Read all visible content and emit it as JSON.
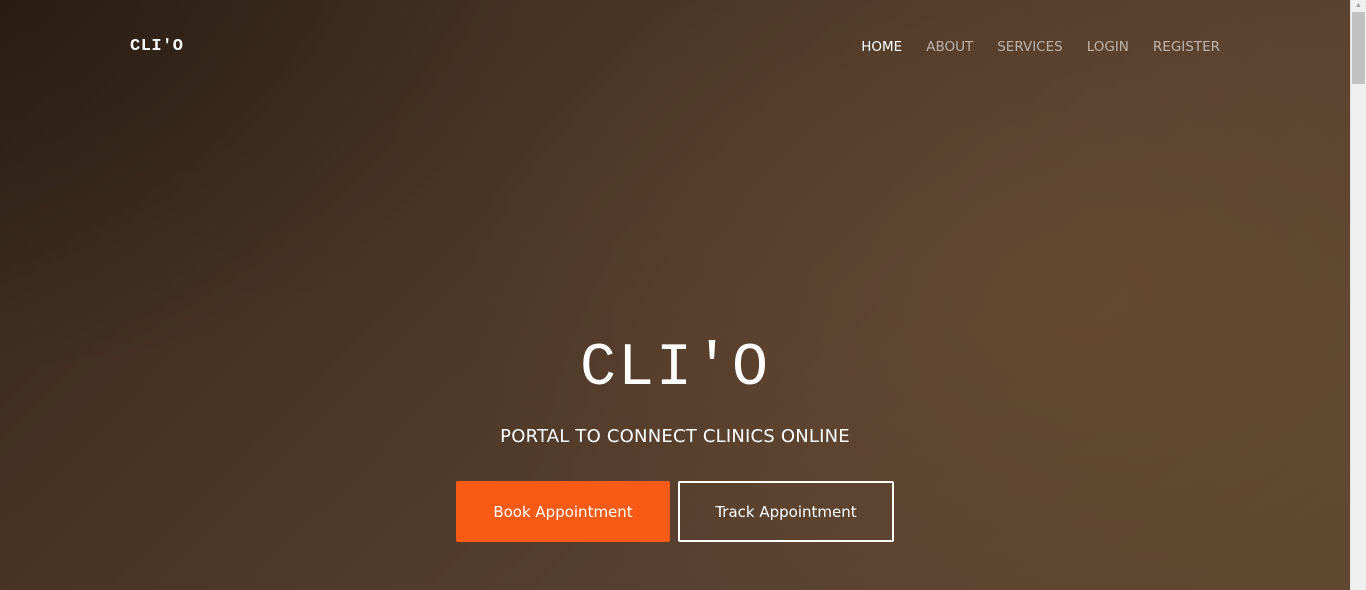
{
  "navbar": {
    "brand": "CLI'O",
    "links": [
      {
        "label": "HOME",
        "active": true
      },
      {
        "label": "ABOUT",
        "active": false
      },
      {
        "label": "SERVICES",
        "active": false
      },
      {
        "label": "LOGIN",
        "active": false
      },
      {
        "label": "REGISTER",
        "active": false
      }
    ]
  },
  "hero": {
    "title": "CLI'O",
    "subtitle": "PORTAL TO CONNECT CLINICS ONLINE",
    "primary_button": "Book Appointment",
    "secondary_button": "Track Appointment"
  },
  "colors": {
    "accent": "#f95b16",
    "background_dark": "#33251a",
    "background_light": "#5e4630",
    "text": "#ffffff"
  },
  "scrollbar": {
    "up_arrow_icon": "chevron-up-icon"
  }
}
